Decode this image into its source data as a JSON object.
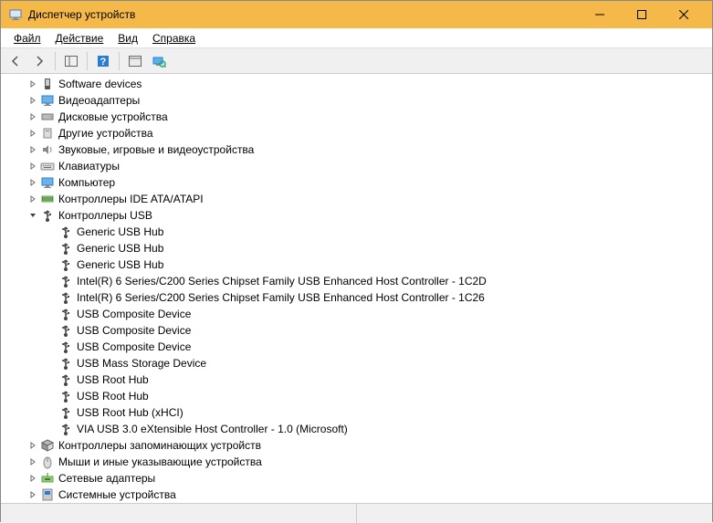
{
  "window": {
    "title": "Диспетчер устройств"
  },
  "menu": {
    "file": "Файл",
    "action": "Действие",
    "view": "Вид",
    "help": "Справка"
  },
  "tree": {
    "software_devices": "Software devices",
    "video_adapters": "Видеоадаптеры",
    "disk_drives": "Дисковые устройства",
    "other_devices": "Другие устройства",
    "sound_game_video": "Звуковые, игровые и видеоустройства",
    "keyboards": "Клавиатуры",
    "computer": "Компьютер",
    "ide_controllers": "Контроллеры IDE ATA/ATAPI",
    "usb_controllers": "Контроллеры USB",
    "usb_children": [
      "Generic USB Hub",
      "Generic USB Hub",
      "Generic USB Hub",
      "Intel(R) 6 Series/C200 Series Chipset Family USB Enhanced Host Controller - 1C2D",
      "Intel(R) 6 Series/C200 Series Chipset Family USB Enhanced Host Controller - 1C26",
      "USB Composite Device",
      "USB Composite Device",
      "USB Composite Device",
      "USB Mass Storage Device",
      "USB Root Hub",
      "USB Root Hub",
      "USB Root Hub (xHCI)",
      "VIA USB 3.0 eXtensible Host Controller - 1.0 (Microsoft)"
    ],
    "storage_controllers": "Контроллеры запоминающих устройств",
    "mice_pointing": "Мыши и иные указывающие устройства",
    "network_adapters": "Сетевые адаптеры",
    "system_devices": "Системные устройства"
  }
}
